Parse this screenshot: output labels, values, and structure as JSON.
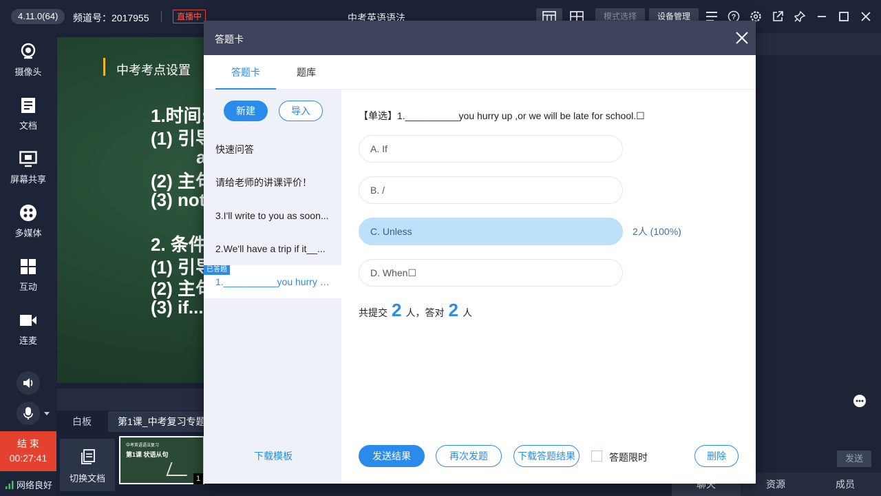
{
  "app": {
    "version": "4.11.0(64)",
    "channel": "频道号：2017955",
    "live_badge": "直播中",
    "doc_title": "中考英语语法",
    "mode_select": "模式选择",
    "device_manage": "设备管理"
  },
  "sidebar": {
    "items": [
      {
        "label": "摄像头",
        "icon": "camera-icon"
      },
      {
        "label": "文档",
        "icon": "document-icon"
      },
      {
        "label": "屏幕共享",
        "icon": "screen-share-icon"
      },
      {
        "label": "多媒体",
        "icon": "multimedia-icon"
      },
      {
        "label": "互动",
        "icon": "interaction-icon"
      },
      {
        "label": "连麦",
        "icon": "video-call-icon"
      }
    ],
    "end_label": "结 束",
    "timer": "00:27:41",
    "network": "网络良好"
  },
  "stage": {
    "heading": "中考考点设置",
    "lines": [
      "1.时间:",
      "(1) 引导",
      "a",
      "(2) 主句",
      "(3) not",
      "2. 条件",
      "(1) 引导",
      "(2) 主句",
      "(3) if..."
    ]
  },
  "bottom": {
    "whiteboard_tab": "白板",
    "lesson_tab": "第1课_中考复习专题",
    "switch_doc": "切换文档",
    "thumb_page": "1",
    "thumb_text": [
      "中考英语语法复习",
      "第1课 状语从句"
    ]
  },
  "right": {
    "send": "发送",
    "tabs": [
      "聊天",
      "资源",
      "成员"
    ]
  },
  "modal": {
    "title": "答题卡",
    "tabs": [
      "答题卡",
      "题库"
    ],
    "new_btn": "新建",
    "import_btn": "导入",
    "list": [
      "快速问答",
      "请给老师的讲课评价！",
      "3.I'll write to you as soon...",
      "2.We'll have a trip if it__...",
      "1.__________you hurry u..."
    ],
    "answered_tag": "已答题",
    "download_template": "下载模板",
    "question": "【单选】1.__________you hurry up ,or we will be late for school.☐",
    "options": [
      {
        "label": "A. If",
        "stat": ""
      },
      {
        "label": "B. /",
        "stat": ""
      },
      {
        "label": "C. Unless",
        "stat": "2人 (100%)"
      },
      {
        "label": "D. When☐",
        "stat": ""
      }
    ],
    "summary": {
      "prefix": "共提交",
      "submitted": "2",
      "mid": "人，答对",
      "correct": "2",
      "suffix": "人"
    },
    "footer": {
      "send_result": "发送结果",
      "resend": "再次发题",
      "download_result": "下载答题结果",
      "time_limit": "答题限时",
      "delete": "删除"
    }
  },
  "colors": {
    "accent": "#2b8bea",
    "header": "#3c435a",
    "end_red": "#e5412f"
  }
}
